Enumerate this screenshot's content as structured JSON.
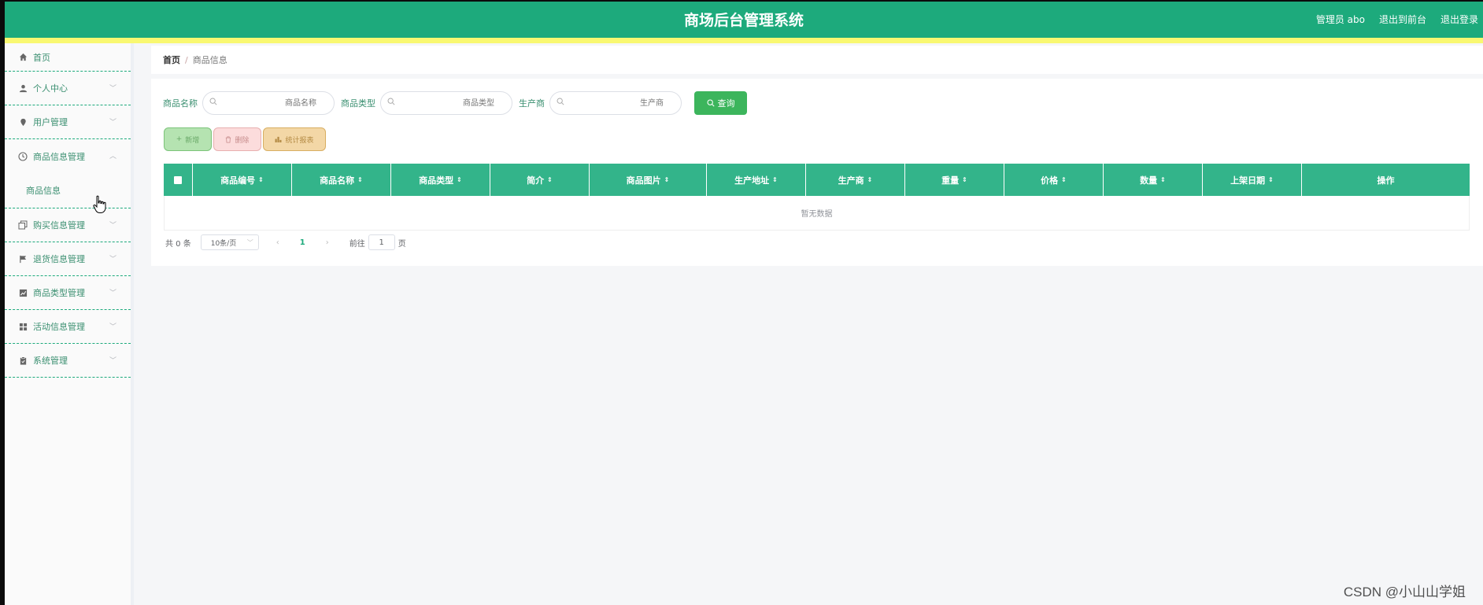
{
  "header": {
    "title": "商场后台管理系统",
    "user": "管理员 abo",
    "to_front": "退出到前台",
    "logout": "退出登录",
    "bg_color": "#1daa7c",
    "strip_color": "#f9f871"
  },
  "sidebar": {
    "items": [
      {
        "label": "首页",
        "icon": "home-icon"
      },
      {
        "label": "个人中心",
        "icon": "user-icon"
      },
      {
        "label": "用户管理",
        "icon": "location-pin-icon"
      },
      {
        "label": "商品信息管理",
        "icon": "clock-icon",
        "expanded": true
      },
      {
        "label": "购买信息管理",
        "icon": "copy-icon"
      },
      {
        "label": "退货信息管理",
        "icon": "flag-icon"
      },
      {
        "label": "商品类型管理",
        "icon": "chart-icon"
      },
      {
        "label": "活动信息管理",
        "icon": "grid-icon"
      },
      {
        "label": "系统管理",
        "icon": "clipboard-icon"
      }
    ],
    "submenu": {
      "label": "商品信息"
    }
  },
  "breadcrumb": {
    "home": "首页",
    "separator": "/",
    "current": "商品信息"
  },
  "search": {
    "name_label": "商品名称",
    "name_placeholder": "商品名称",
    "type_label": "商品类型",
    "type_placeholder": "商品类型",
    "maker_label": "生产商",
    "maker_placeholder": "生产商",
    "query_label": "查询"
  },
  "actions": {
    "add": "新增",
    "delete": "删除",
    "stats": "统计报表"
  },
  "table": {
    "columns": [
      "商品编号",
      "商品名称",
      "商品类型",
      "简介",
      "商品图片",
      "生产地址",
      "生产商",
      "重量",
      "价格",
      "数量",
      "上架日期",
      "操作"
    ],
    "empty_text": "暂无数据",
    "header_color": "#33b48a"
  },
  "pagination": {
    "total": "共 0 条",
    "page_size": "10条/页",
    "current_page": "1",
    "goto_label": "前往",
    "goto_value": "1",
    "page_suffix": "页"
  },
  "watermark": "CSDN @小山山学姐"
}
